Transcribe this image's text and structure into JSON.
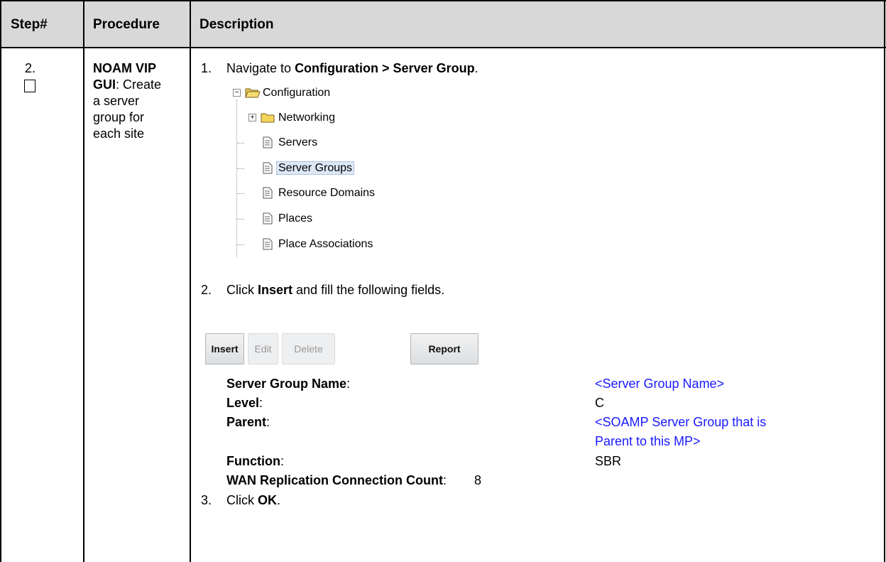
{
  "table": {
    "headers": {
      "step": "Step#",
      "procedure": "Procedure",
      "description": "Description"
    },
    "step_number": "2.",
    "procedure": {
      "bold": "NOAM VIP GUI",
      "rest": ": Create a server group for each site"
    },
    "procedure_lines": [
      "NOAM VIP",
      "GUI",
      ": Create",
      "a server",
      "group for",
      "each site"
    ]
  },
  "instructions": {
    "step1": {
      "num": "1.",
      "pre": "Navigate to ",
      "bold": "Configuration > Server Group",
      "post": "."
    },
    "step2": {
      "num": "2.",
      "pre": "Click ",
      "bold": "Insert",
      "post": " and fill the following fields."
    },
    "step3": {
      "num": "3.",
      "pre": "Click ",
      "bold": "OK",
      "post": "."
    }
  },
  "tree": {
    "root": "Configuration",
    "items": [
      {
        "label": "Networking",
        "icon": "folder-icon"
      },
      {
        "label": "Servers",
        "icon": "page-icon"
      },
      {
        "label": "Server Groups",
        "icon": "page-icon",
        "selected": true
      },
      {
        "label": "Resource Domains",
        "icon": "page-icon"
      },
      {
        "label": "Places",
        "icon": "page-icon"
      },
      {
        "label": "Place Associations",
        "icon": "page-icon"
      }
    ]
  },
  "toolbar": {
    "insert": "Insert",
    "edit": "Edit",
    "delete": "Delete",
    "report": "Report"
  },
  "fields": [
    {
      "label": "Server Group Name",
      "value": "<Server Group Name>",
      "value_color": "#1a1aff"
    },
    {
      "label": "Level",
      "value": "C"
    },
    {
      "label": "Parent",
      "value_line1": "<SOAMP Server Group that is",
      "value_line2": "Parent to this MP>",
      "value_color": "#1a1aff"
    },
    {
      "label": "Function",
      "value": "SBR"
    },
    {
      "label": "WAN Replication Connection Count",
      "value": "8"
    }
  ],
  "colors": {
    "header_bg": "#d8d8d8",
    "link_blue": "#1a1aff",
    "selected_bg": "#dde8f6"
  }
}
